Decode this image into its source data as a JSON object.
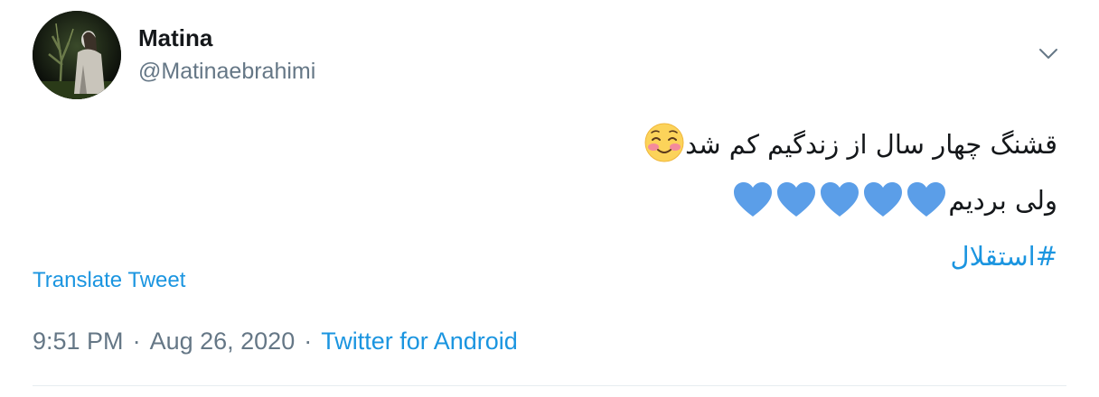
{
  "tweet": {
    "author": {
      "display_name": "Matina",
      "handle": "@Matinaebrahimi"
    },
    "text": {
      "line1": "قشنگ چهار سال از زندگیم کم شد",
      "line2": "ولی بردیم",
      "hashtag": "#استقلال",
      "line1_emoji": "smiling-face-with-blush-emoji",
      "line2_emoji": "blue-heart-emoji",
      "line2_emoji_count": 5
    },
    "translate_label": "Translate Tweet",
    "meta": {
      "time": "9:51 PM",
      "separator": "·",
      "date": "Aug 26, 2020",
      "source": "Twitter for Android"
    }
  },
  "colors": {
    "link": "#1b95e0",
    "secondary_text": "#657786",
    "primary_text": "#14171a",
    "divider": "#e6ecf0",
    "heart": "#5b9ee8"
  },
  "icons": {
    "more_menu": "chevron-down-icon"
  }
}
